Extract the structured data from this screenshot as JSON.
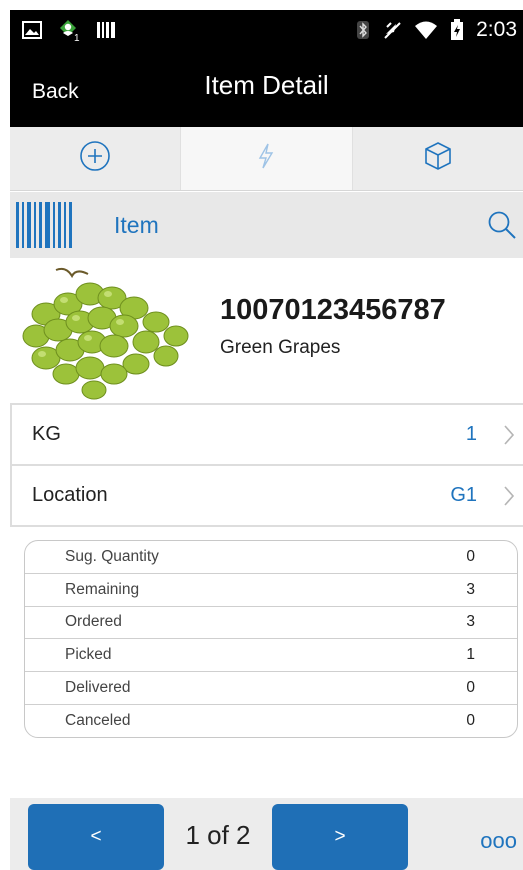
{
  "status_bar": {
    "time": "2:03",
    "icons": [
      "image-icon",
      "account-sync-icon",
      "barcode-icon",
      "bluetooth-icon",
      "mute-icon",
      "wifi-icon",
      "battery-icon"
    ]
  },
  "header": {
    "back_label": "Back",
    "title": "Item Detail"
  },
  "tabs": [
    {
      "icon": "add-circle-icon",
      "active": false
    },
    {
      "icon": "lightning-icon",
      "active": true
    },
    {
      "icon": "box-icon",
      "active": false
    }
  ],
  "scan": {
    "label": "Item",
    "scan_icon": "barcode-icon",
    "search_icon": "search-icon"
  },
  "item": {
    "number": "10070123456787",
    "description": "Green Grapes",
    "image": "green-grapes-image"
  },
  "detail_rows": [
    {
      "label": "KG",
      "value": "1"
    },
    {
      "label": "Location",
      "value": "G1"
    }
  ],
  "quantities": [
    {
      "label": "Sug. Quantity",
      "value": "0"
    },
    {
      "label": "Remaining",
      "value": "3"
    },
    {
      "label": "Ordered",
      "value": "3"
    },
    {
      "label": "Picked",
      "value": "1"
    },
    {
      "label": "Delivered",
      "value": "0"
    },
    {
      "label": "Canceled",
      "value": "0"
    }
  ],
  "footer": {
    "prev_label": "<",
    "next_label": ">",
    "pager": "1 of 2",
    "more_label": "ooo"
  },
  "colors": {
    "accent": "#1f74be",
    "button": "#1f6fb6",
    "header_bg": "#000000"
  }
}
